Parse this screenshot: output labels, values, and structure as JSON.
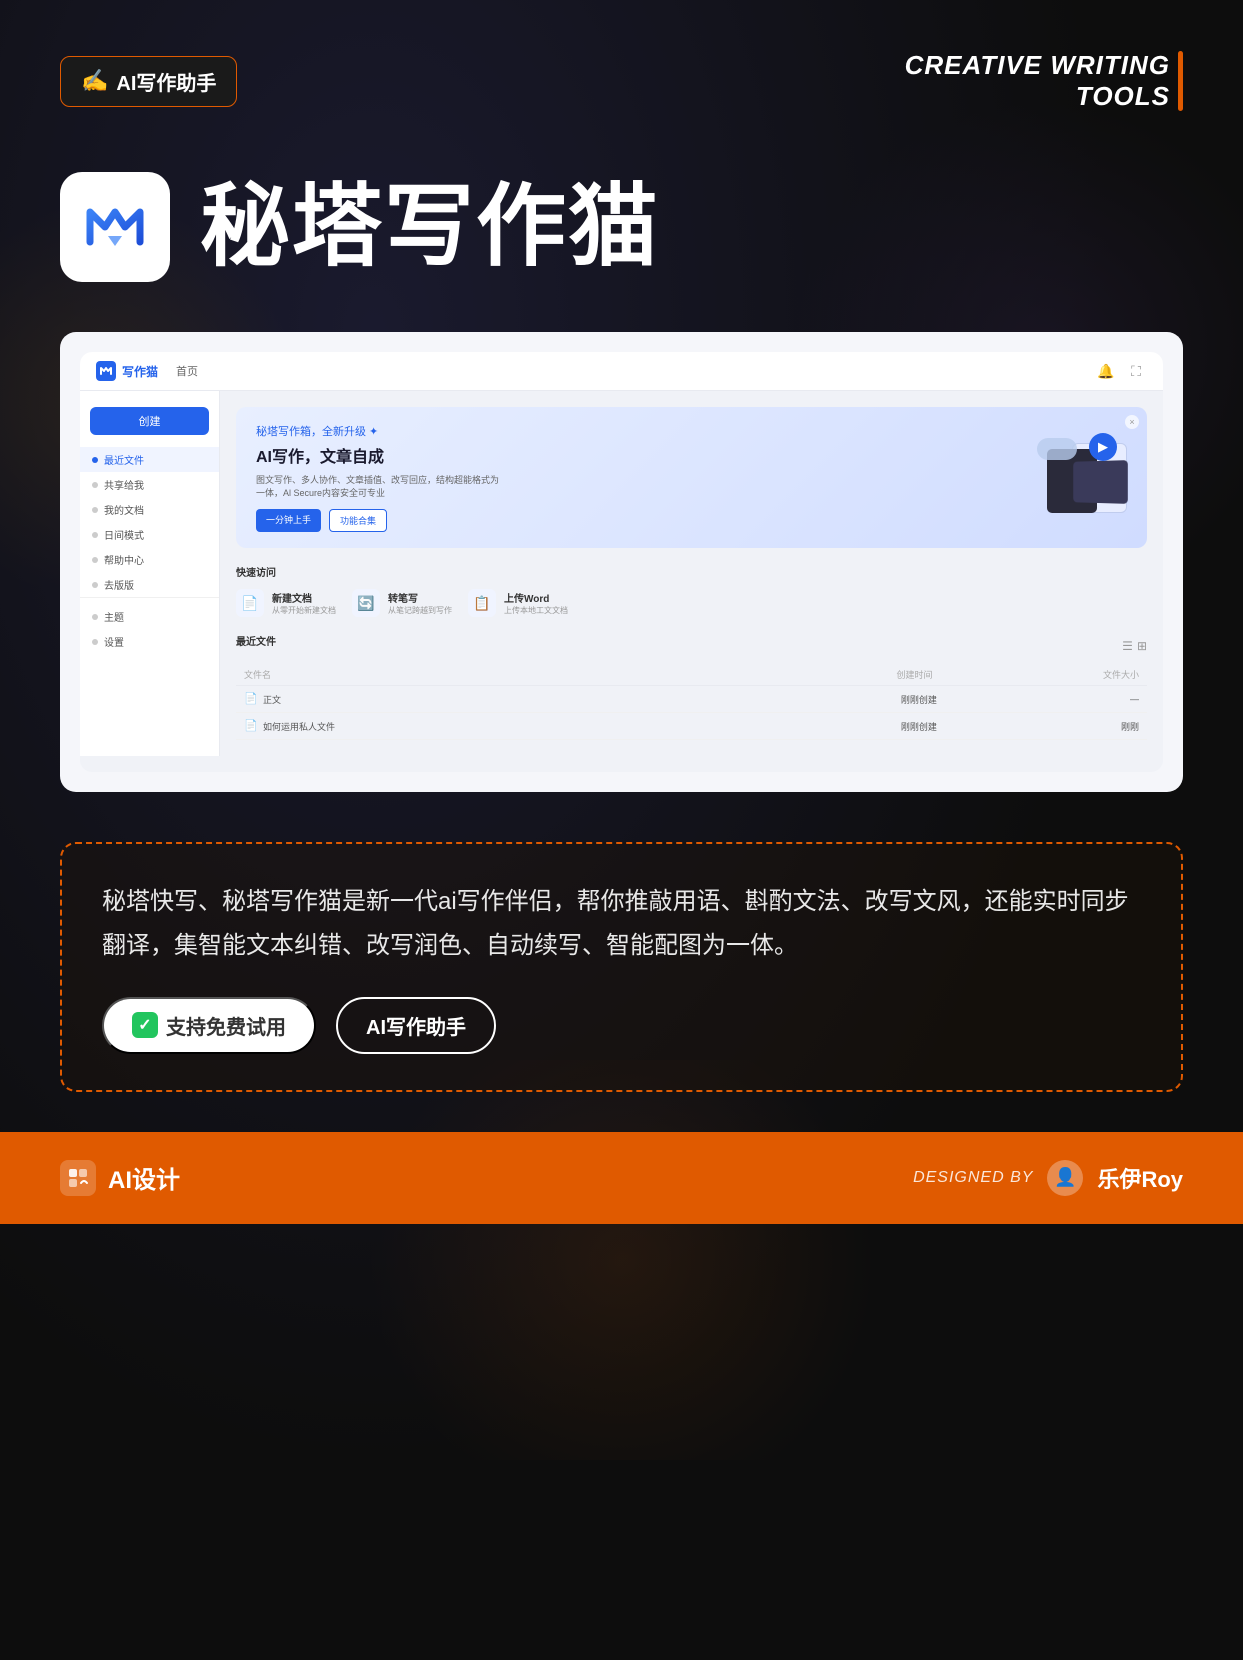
{
  "header": {
    "badge_icon": "✍️",
    "badge_label": "AI写作助手",
    "creative_title_line1": "CREATIVE WRITING",
    "creative_title_line2": "TOOLS"
  },
  "app": {
    "name": "秘塔写作猫",
    "icon_alt": "AI logo"
  },
  "screenshot": {
    "logo_text": "写作猫",
    "nav_tab": "首页",
    "hero_subtitle": "秘塔写作箱，全新升级 ✦",
    "hero_title": "AI写作，文章自成",
    "hero_desc": "图文写作、多人协作、文章插值、改写回应，结构超能格式为一体，Al Secure内容安全可专业",
    "hero_btn1": "一分钟上手",
    "hero_btn2": "功能合集",
    "sidebar": {
      "create_btn": "创建",
      "items": [
        {
          "label": "最近文件",
          "active": true
        },
        {
          "label": "共享给我"
        },
        {
          "label": "我的文档"
        },
        {
          "label": "日间模式"
        },
        {
          "label": "帮助中心"
        },
        {
          "label": "去版版"
        }
      ],
      "bottom_items": [
        {
          "label": "主题"
        },
        {
          "label": "设置"
        }
      ]
    },
    "quick_access_title": "快速访问",
    "quick_items": [
      {
        "icon": "📄",
        "name": "新建文档",
        "desc": "从零开始新建文档"
      },
      {
        "icon": "🔄",
        "name": "转笔写",
        "desc": "从笔记跨越到写作"
      },
      {
        "icon": "📋",
        "name": "上传Word",
        "desc": "上传本地工文文档"
      }
    ],
    "recent_title": "最近文件",
    "table_headers": [
      "文件名",
      "创建时间",
      "文件大小"
    ],
    "table_rows": [
      {
        "icon": "📄",
        "name": "正文",
        "date": "刚刚创建",
        "size": "—"
      },
      {
        "icon": "📄",
        "name": "如何运用私人文件",
        "date": "刚刚创建",
        "size": "刚刚"
      }
    ]
  },
  "description": {
    "text": "秘塔快写、秘塔写作猫是新一代ai写作伴侣，帮你推敲用语、斟酌文法、改写文风，还能实时同步翻译，集智能文本纠错、改写润色、自动续写、智能配图为一体。",
    "btn_free_check": "✓",
    "btn_free_label": "支持免费试用",
    "btn_ai_label": "AI写作助手"
  },
  "footer": {
    "logo_text": "AI设计",
    "designed_by": "DESIGNED BY",
    "author": "乐伊Roy"
  }
}
